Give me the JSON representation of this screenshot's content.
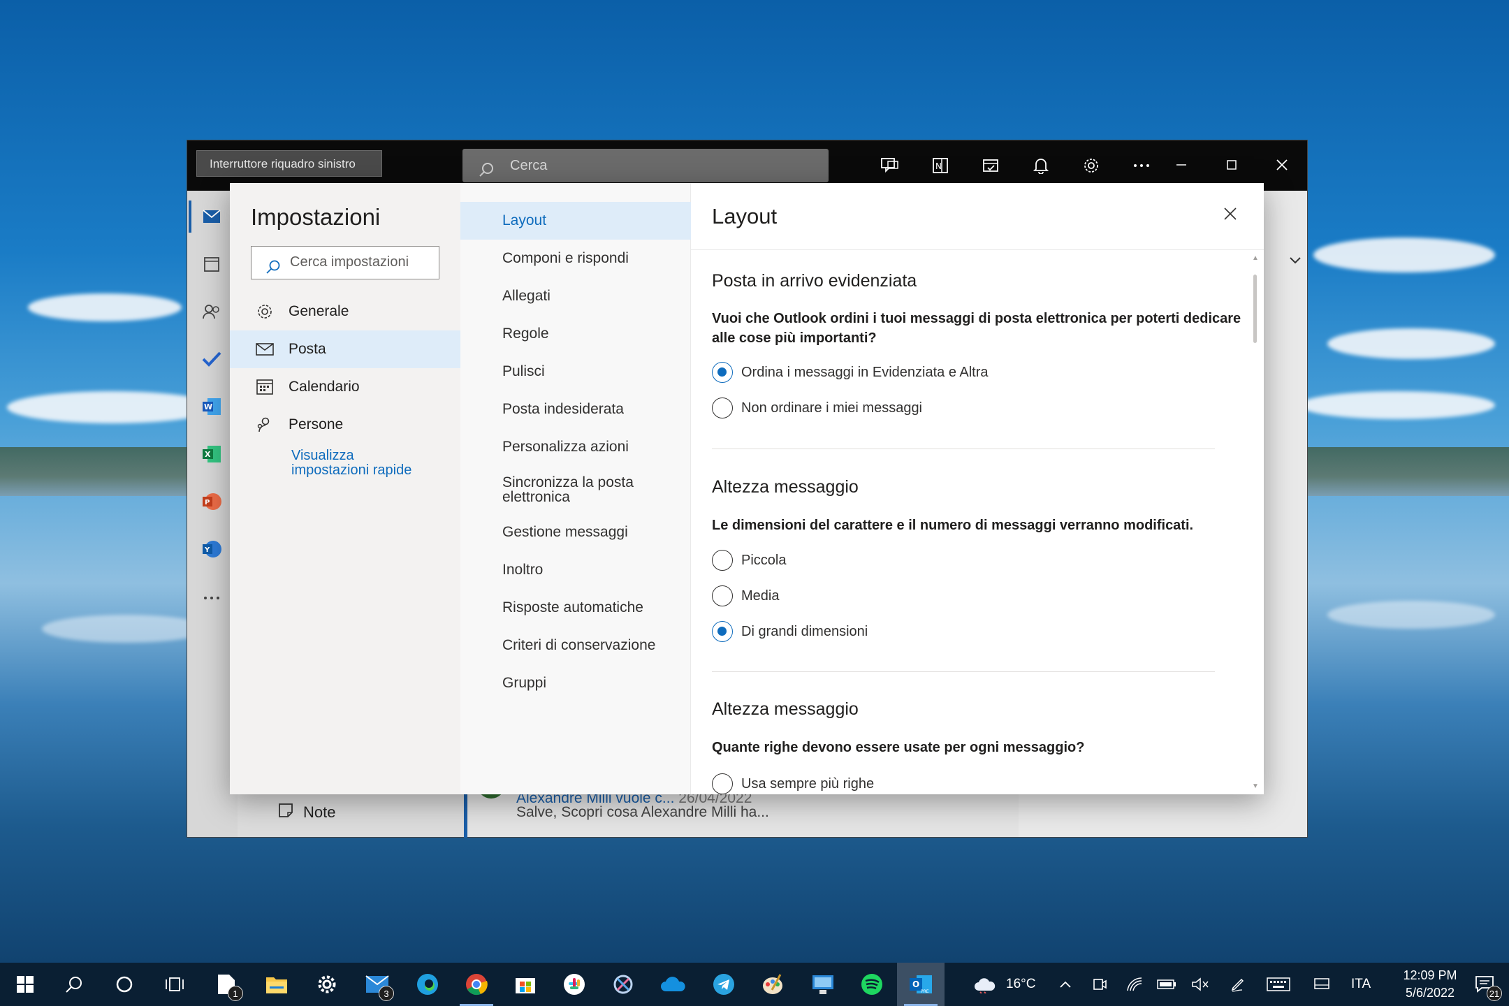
{
  "outlook_window": {
    "left_pane_toggle": "Interruttore riquadro sinistro",
    "search_placeholder": "Cerca",
    "note_label": "Note",
    "message": {
      "from": "Alexandre Milli vuole c...",
      "date": "26/04/2022",
      "preview": "Salve, Scopri cosa Alexandre Milli ha..."
    },
    "rail_icons": [
      "mail-icon",
      "calendar-icon",
      "people-icon",
      "todo-check-icon",
      "word-icon",
      "excel-icon",
      "powerpoint-icon",
      "yammer-icon",
      "more-icon"
    ],
    "toolbar_icons": [
      "chat-icon",
      "onenote-icon",
      "my-day-icon",
      "bell-icon",
      "gear-icon",
      "more-icon"
    ]
  },
  "settings": {
    "title": "Impostazioni",
    "search_placeholder": "Cerca impostazioni",
    "categories": [
      {
        "label": "Generale",
        "icon": "gear-icon",
        "selected": false
      },
      {
        "label": "Posta",
        "icon": "mail-icon",
        "selected": true
      },
      {
        "label": "Calendario",
        "icon": "calendar-icon",
        "selected": false
      },
      {
        "label": "Persone",
        "icon": "people-icon",
        "selected": false
      }
    ],
    "quick_settings_link": [
      "Visualizza",
      "impostazioni rapide"
    ],
    "subcategories": [
      {
        "label": "Layout",
        "selected": true
      },
      {
        "label": "Componi e rispondi"
      },
      {
        "label": "Allegati"
      },
      {
        "label": "Regole"
      },
      {
        "label": "Pulisci"
      },
      {
        "label": "Posta indesiderata"
      },
      {
        "label": "Personalizza azioni"
      },
      {
        "label": [
          "Sincronizza la posta",
          "elettronica"
        ]
      },
      {
        "label": "Gestione messaggi"
      },
      {
        "label": "Inoltro"
      },
      {
        "label": "Risposte automatiche"
      },
      {
        "label": "Criteri di conservazione"
      },
      {
        "label": "Gruppi"
      }
    ],
    "pane": {
      "title": "Layout",
      "sections": [
        {
          "heading": "Posta in arrivo evidenziata",
          "question": "Vuoi che Outlook ordini i tuoi messaggi di posta elettronica per poterti dedicare alle cose più importanti?",
          "options": [
            {
              "label": "Ordina i messaggi in Evidenziata e Altra",
              "checked": true
            },
            {
              "label": "Non ordinare i miei messaggi",
              "checked": false
            }
          ]
        },
        {
          "heading": "Altezza messaggio",
          "question": "Le dimensioni del carattere e il numero di messaggi verranno modificati.",
          "options": [
            {
              "label": "Piccola",
              "checked": false
            },
            {
              "label": "Media",
              "checked": false
            },
            {
              "label": "Di grandi dimensioni",
              "checked": true
            }
          ]
        },
        {
          "heading": "Altezza messaggio",
          "question": "Quante righe devono essere usate per ogni messaggio?",
          "options": [
            {
              "label": "Usa sempre più righe",
              "checked": false
            }
          ]
        }
      ]
    }
  },
  "taskbar": {
    "apps": [
      "windows-start-icon",
      "search-icon",
      "cortana-icon",
      "task-view-icon",
      "files-icon",
      "file-explorer-icon",
      "settings-icon",
      "mail-icon",
      "edge-icon",
      "chrome-icon",
      "store-icon",
      "slack-icon",
      "snip-icon",
      "onedrive-icon",
      "telegram-icon",
      "paint-icon",
      "remote-desktop-icon",
      "spotify-icon",
      "outlook-icon"
    ],
    "files_badge": "1",
    "mail_badge": "3",
    "weather": "16°C",
    "language": "ITA",
    "time": "12:09 PM",
    "date": "5/6/2022",
    "notifications_badge": "21"
  }
}
